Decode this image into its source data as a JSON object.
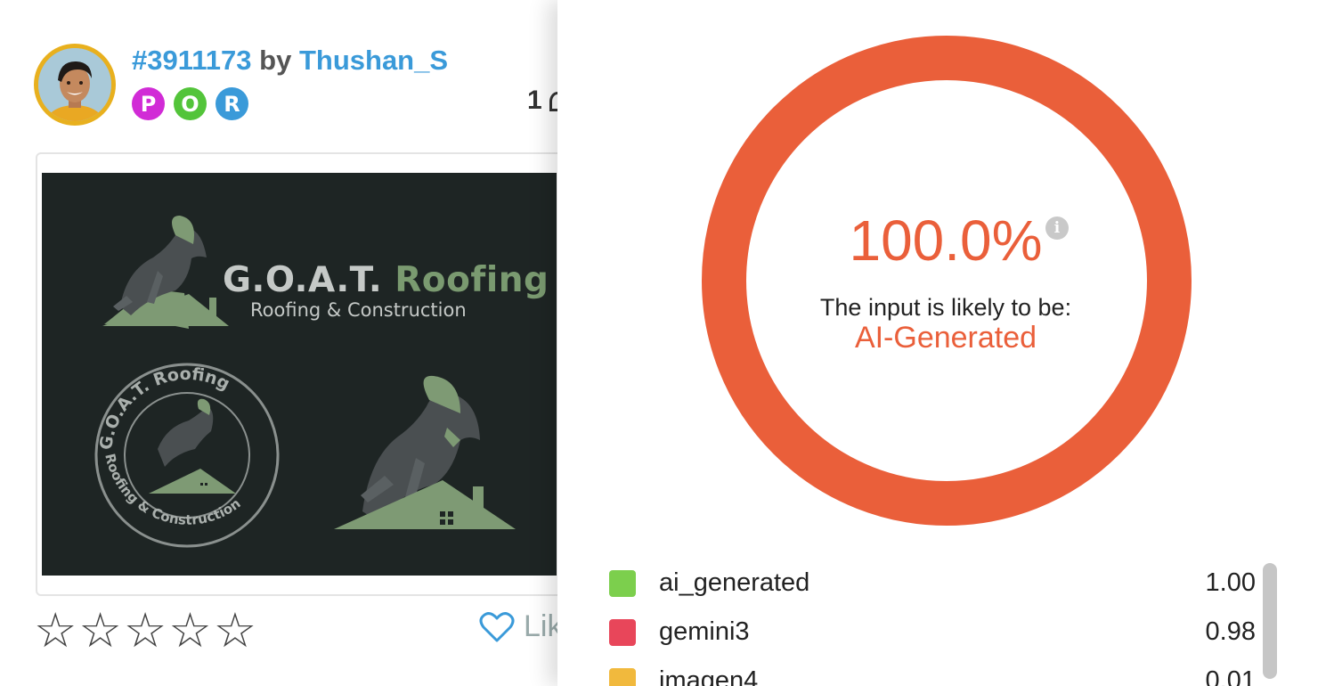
{
  "entry": {
    "id": "#3911173",
    "by": "by",
    "author": "Thushan_S",
    "badges": [
      {
        "letter": "P",
        "color": "#d12bd6"
      },
      {
        "letter": "O",
        "color": "#53c43a"
      },
      {
        "letter": "R",
        "color": "#3a9ad9"
      }
    ],
    "comments": "1",
    "rating_stars": 0,
    "like_label": "Lik"
  },
  "design": {
    "brand": "G.O.A.T.",
    "brand_accent": "Roofing",
    "tagline": "Roofing & Construction",
    "seal_top": "G.O.A.T. Roofing",
    "seal_bottom": "Roofing & Construction"
  },
  "detector": {
    "score_text": "100.0%",
    "score_fraction": 1.0,
    "likely_label": "The input is likely to be:",
    "verdict": "AI-Generated",
    "accent": "#ea5f3a",
    "results": [
      {
        "name": "ai_generated",
        "value": "1.00",
        "color": "#7ccf4d"
      },
      {
        "name": "gemini3",
        "value": "0.98",
        "color": "#e8465a"
      },
      {
        "name": "imagen4",
        "value": "0.01",
        "color": "#f1b93d"
      }
    ]
  }
}
